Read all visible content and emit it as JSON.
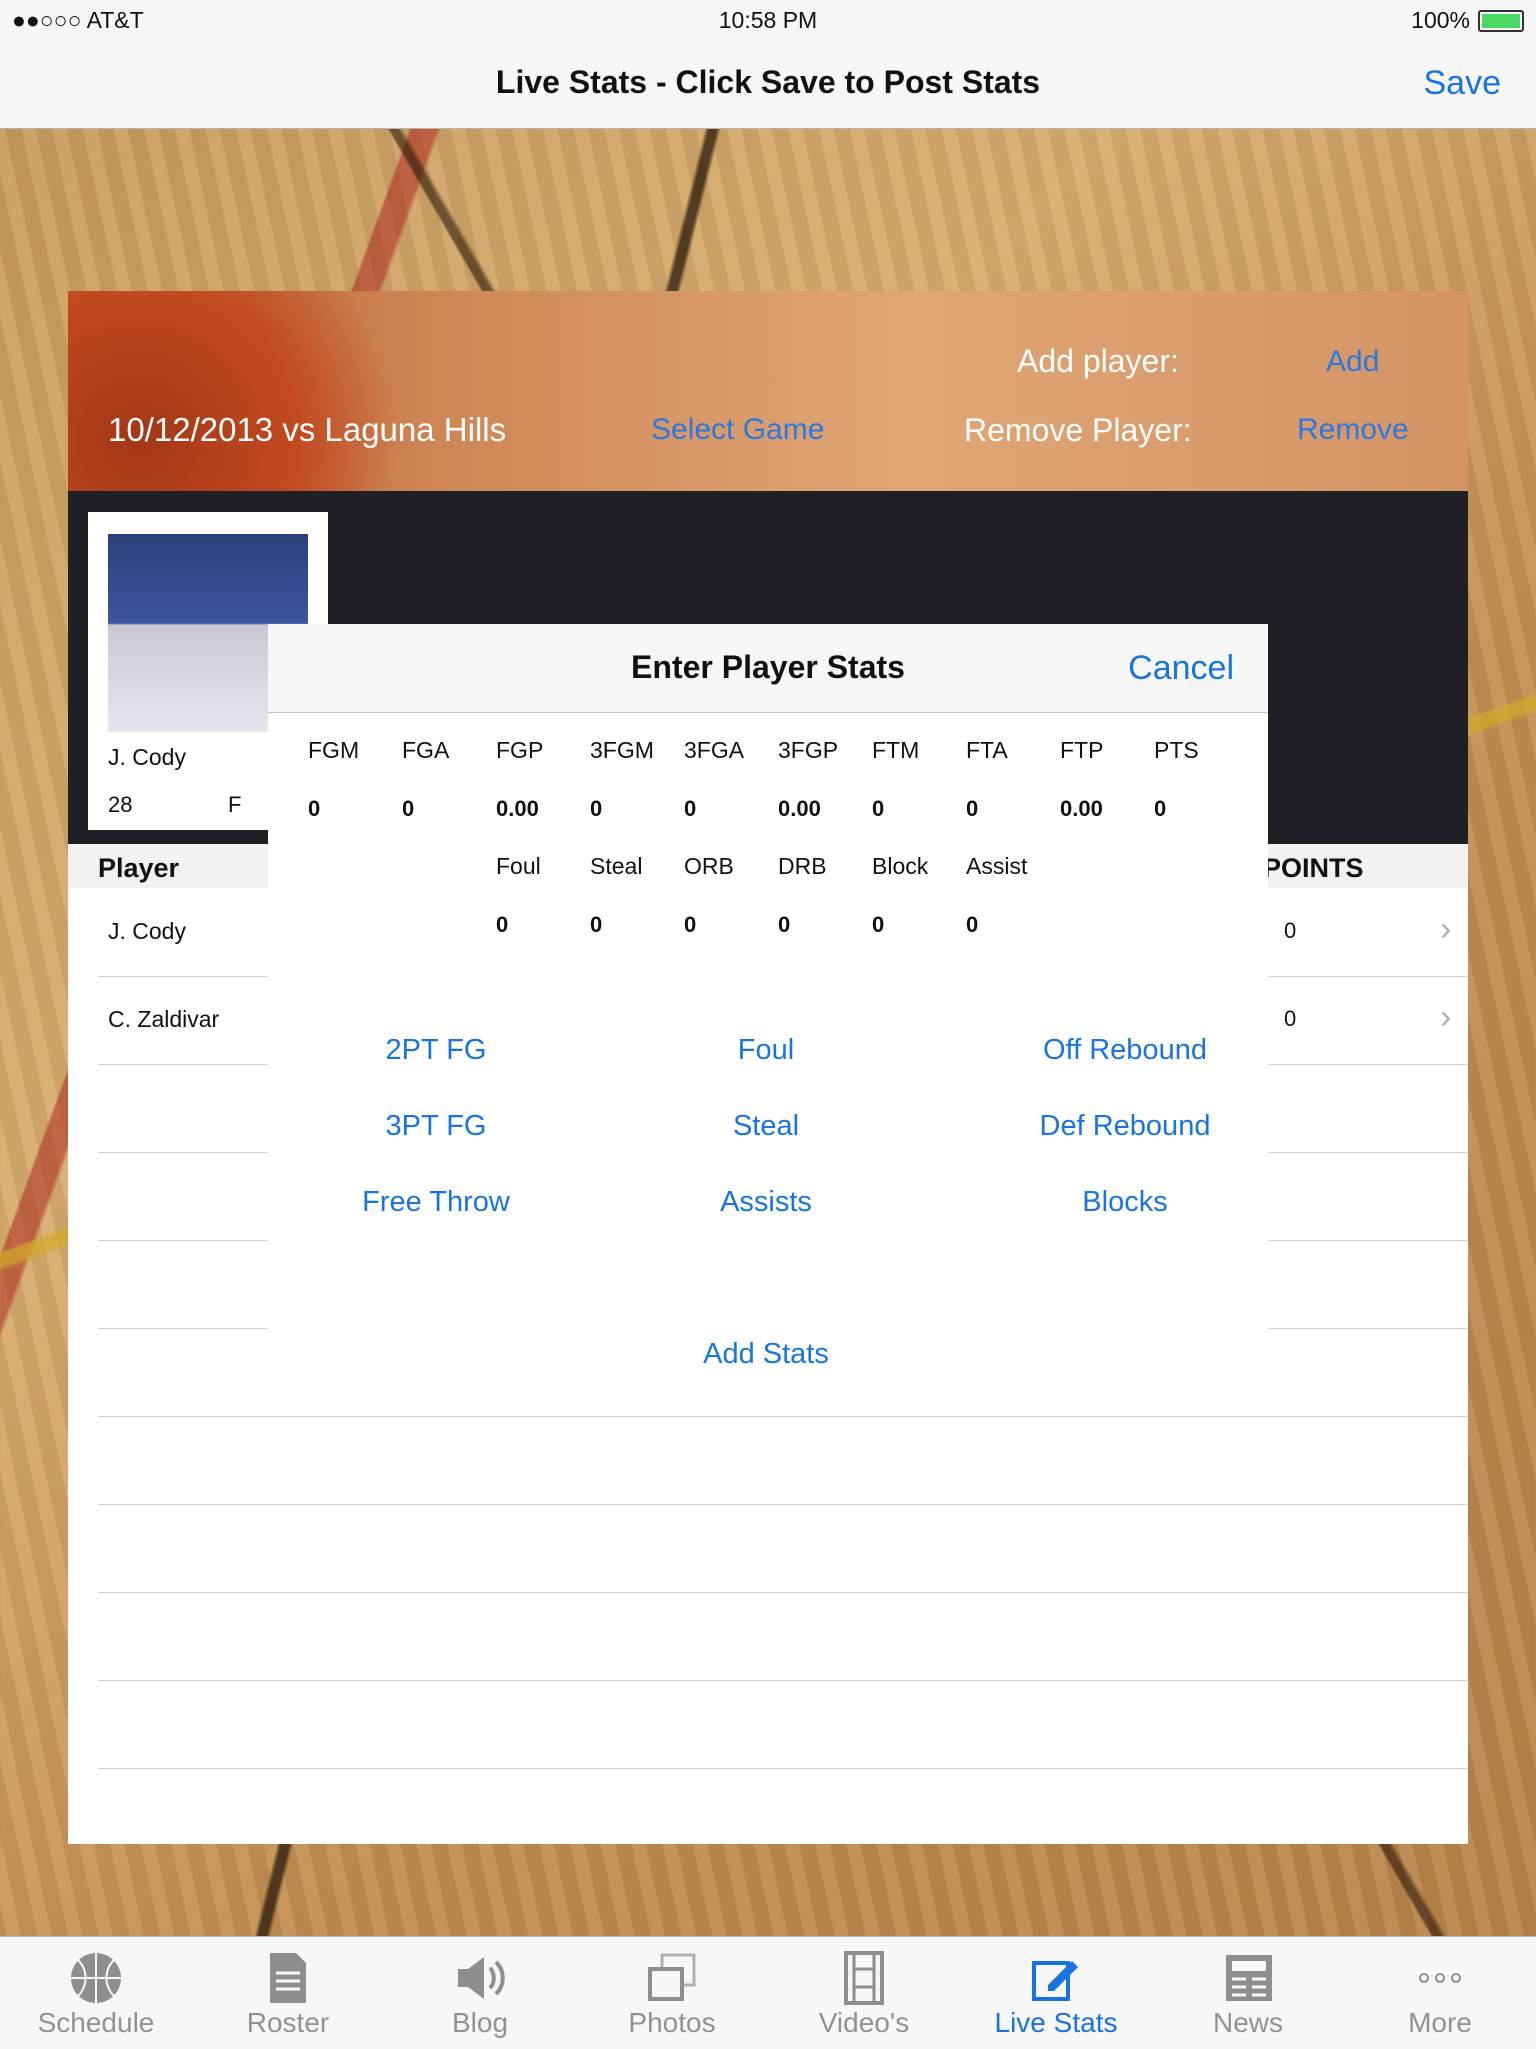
{
  "status": {
    "carrier": "●●○○○ AT&T",
    "time": "10:58 PM",
    "battery": "100%"
  },
  "nav": {
    "title": "Live Stats - Click Save to Post Stats",
    "save": "Save"
  },
  "banner": {
    "game": "10/12/2013 vs Laguna Hills",
    "select_game": "Select Game",
    "add_label": "Add player:",
    "add": "Add",
    "remove_label": "Remove Player:",
    "remove": "Remove"
  },
  "player_card": {
    "name": "J. Cody",
    "number": "28",
    "position": "F"
  },
  "table": {
    "header_player": "Player",
    "header_points": "POINTS",
    "rows": [
      {
        "name": "J. Cody",
        "points": "0"
      },
      {
        "name": "C. Zaldivar",
        "points": "0"
      }
    ]
  },
  "modal": {
    "title": "Enter Player Stats",
    "cancel": "Cancel",
    "row1_labels": [
      "FGM",
      "FGA",
      "FGP",
      "3FGM",
      "3FGA",
      "3FGP",
      "FTM",
      "FTA",
      "FTP",
      "PTS"
    ],
    "row1_values": [
      "0",
      "0",
      "0.00",
      "0",
      "0",
      "0.00",
      "0",
      "0",
      "0.00",
      "0"
    ],
    "row2_labels": [
      "Foul",
      "Steal",
      "ORB",
      "DRB",
      "Block",
      "Assist"
    ],
    "row2_values": [
      "0",
      "0",
      "0",
      "0",
      "0",
      "0"
    ],
    "actions": {
      "pt2": "2PT FG",
      "foul": "Foul",
      "off_reb": "Off Rebound",
      "pt3": "3PT FG",
      "steal": "Steal",
      "def_reb": "Def Rebound",
      "ft": "Free Throw",
      "assists": "Assists",
      "blocks": "Blocks"
    },
    "add_stats": "Add Stats"
  },
  "tabs": [
    {
      "label": "Schedule",
      "icon": "basketball-icon"
    },
    {
      "label": "Roster",
      "icon": "document-icon"
    },
    {
      "label": "Blog",
      "icon": "speaker-icon"
    },
    {
      "label": "Photos",
      "icon": "photos-icon"
    },
    {
      "label": "Video's",
      "icon": "film-icon"
    },
    {
      "label": "Live Stats",
      "icon": "edit-icon"
    },
    {
      "label": "News",
      "icon": "newspaper-icon"
    },
    {
      "label": "More",
      "icon": "more-icon"
    }
  ],
  "colors": {
    "accent": "#1a74e0",
    "bar": "#f7f7f7",
    "dark_strip": "#1f2026"
  }
}
